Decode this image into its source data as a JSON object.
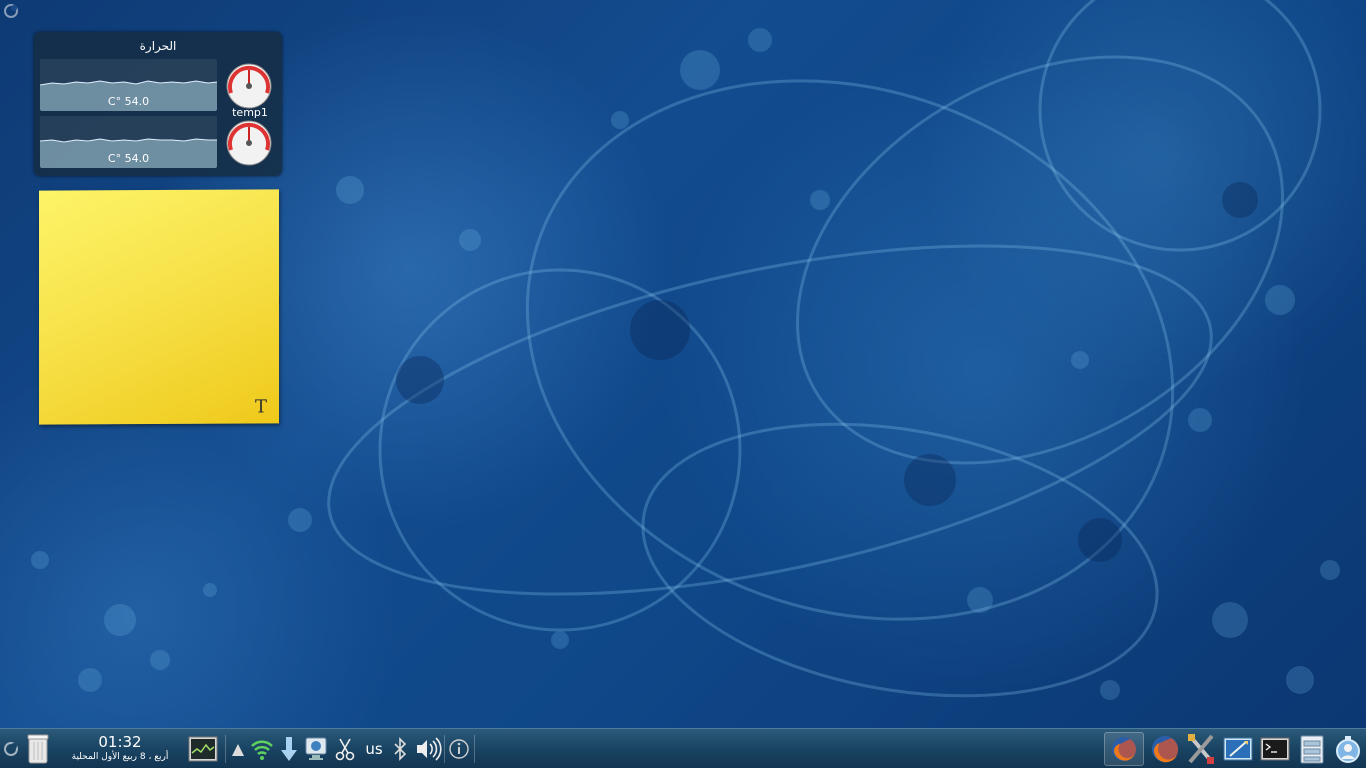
{
  "temp_widget": {
    "title": "الحرارة",
    "sensors": [
      {
        "reading": "C° 54.0",
        "gauge_label": "temp1"
      },
      {
        "reading": "C° 54.0",
        "gauge_label": ""
      }
    ]
  },
  "panel": {
    "clock": {
      "time": "01:32",
      "date": "أربع ، 8 ربيع الأول المحلية"
    },
    "keyboard_layout": "us",
    "launchers": [
      "firefox-icon",
      "system-settings-icon",
      "text-editor-icon",
      "terminal-icon",
      "file-manager-icon",
      "user-icon"
    ]
  },
  "colors": {
    "panel": "#1a4463",
    "note": "#f7e24a",
    "widget": "#142d46"
  }
}
